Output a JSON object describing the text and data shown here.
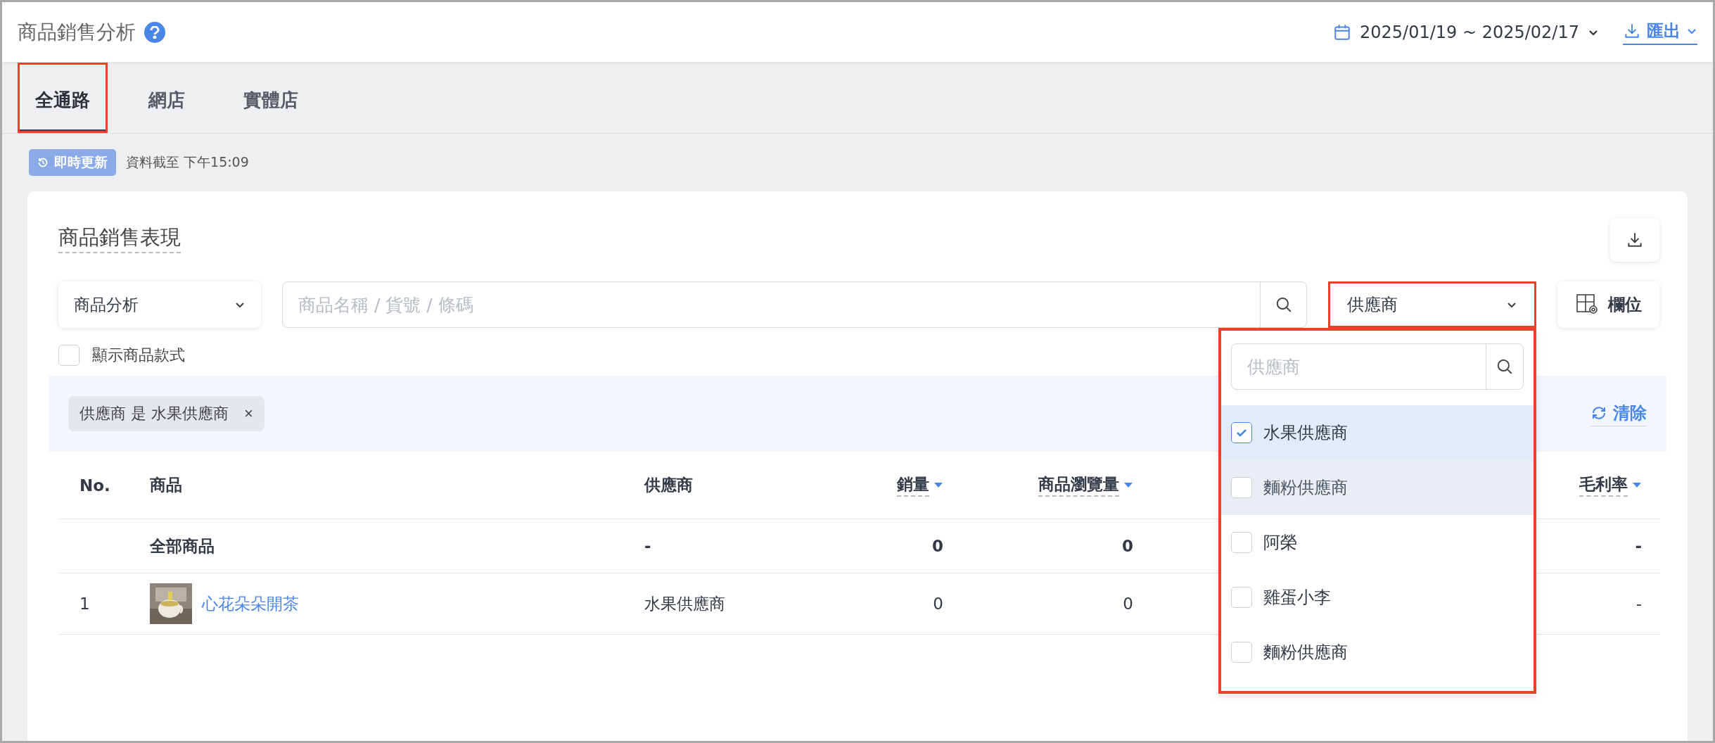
{
  "header": {
    "title": "商品銷售分析",
    "date_range": "2025/01/19 ~ 2025/02/17",
    "export": "匯出"
  },
  "tabs": [
    {
      "label": "全通路",
      "selected": true,
      "highlighted": true
    },
    {
      "label": "網店",
      "selected": false,
      "highlighted": false
    },
    {
      "label": "實體店",
      "selected": false,
      "highlighted": false
    }
  ],
  "status": {
    "badge": "即時更新",
    "note": "資料截至 下午15:09"
  },
  "card": {
    "title": "商品銷售表現",
    "mode_select": "商品分析",
    "search_placeholder": "商品名稱 / 貨號 / 條碼",
    "supplier_select": {
      "label": "供應商",
      "highlighted": true,
      "expanded": true
    },
    "columns_button": "欄位",
    "show_variants": {
      "label": "顯示商品款式",
      "checked": false
    },
    "filter_chip": "供應商 是 水果供應商",
    "filter_chip_close": "×",
    "clear": "清除"
  },
  "table": {
    "columns": [
      {
        "label": "No.",
        "kind": "text"
      },
      {
        "label": "商品",
        "kind": "text"
      },
      {
        "label": "供應商",
        "kind": "text"
      },
      {
        "label": "銷量",
        "kind": "metric"
      },
      {
        "label": "商品瀏覽量",
        "kind": "metric"
      },
      {
        "label": "毛利率",
        "kind": "metric"
      }
    ],
    "rows": [
      {
        "kind": "total",
        "product": "全部商品",
        "supplier": "-",
        "sales": "0",
        "views": "0",
        "margin": "-"
      },
      {
        "kind": "product",
        "no": "1",
        "product": "心花朵朵開茶",
        "supplier": "水果供應商",
        "sales": "0",
        "views": "0",
        "margin": "-"
      }
    ]
  },
  "dropdown": {
    "placeholder": "供應商",
    "options": [
      {
        "label": "水果供應商",
        "checked": true,
        "hovered": false
      },
      {
        "label": "麵粉供應商",
        "checked": false,
        "hovered": true
      },
      {
        "label": "阿榮",
        "checked": false,
        "hovered": false
      },
      {
        "label": "雞蛋小李",
        "checked": false,
        "hovered": false
      },
      {
        "label": "麵粉供應商",
        "checked": false,
        "hovered": false
      }
    ]
  }
}
